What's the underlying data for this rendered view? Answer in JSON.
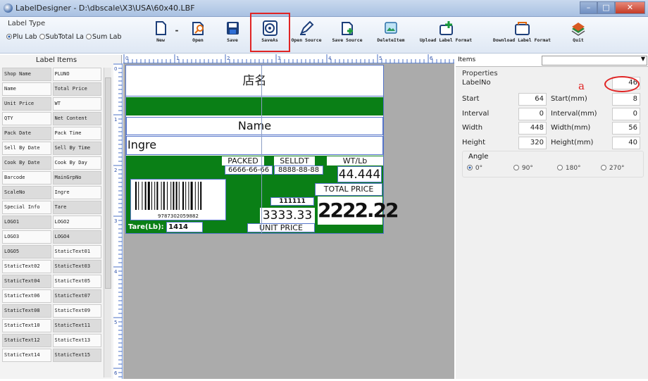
{
  "window": {
    "title": "LabelDesigner - D:\\dbscale\\X3\\USA\\60x40.LBF",
    "min": "–",
    "max": "□",
    "close": "✕"
  },
  "label_type": {
    "title": "Label Type",
    "options": [
      "Plu Lab",
      "SubTotal La",
      "Sum Lab"
    ],
    "selected": 0
  },
  "toolbar": {
    "new": "New",
    "open": "Open",
    "save": "Save",
    "saveas": "SaveAs",
    "open_source": "Open Source",
    "save_source": "Save Source",
    "delete_item": "DeleteItem",
    "upload_label_format": "Upload Label Format",
    "download_label_format": "Download Label Format",
    "quit": "Quit"
  },
  "left_panel": {
    "title": "Label Items",
    "rows": [
      [
        "Shop Name",
        "PLUNO"
      ],
      [
        "Name",
        "Total Price"
      ],
      [
        "Unit Price",
        "WT"
      ],
      [
        "QTY",
        "Net Content"
      ],
      [
        "Pack Date",
        "Pack Time"
      ],
      [
        "Sell By Date",
        "Sell By Time"
      ],
      [
        "Cook By Date",
        "Cook By Day"
      ],
      [
        "Barcode",
        "MainGrpNo"
      ],
      [
        "ScaleNo",
        "Ingre"
      ],
      [
        "Special Info",
        "Tare"
      ],
      [
        "LOGO1",
        "LOGO2"
      ],
      [
        "LOGO3",
        "LOGO4"
      ],
      [
        "LOGO5",
        "StaticText01"
      ],
      [
        "StaticText02",
        "StaticText03"
      ],
      [
        "StaticText04",
        "StaticText05"
      ],
      [
        "StaticText06",
        "StaticText07"
      ],
      [
        "StaticText08",
        "StaticText09"
      ],
      [
        "StaticText10",
        "StaticText11"
      ],
      [
        "StaticText12",
        "StaticText13"
      ],
      [
        "StaticText14",
        "StaticText15"
      ]
    ]
  },
  "ruler": {
    "top_marks": [
      "0",
      "1",
      "2",
      "3",
      "4",
      "5",
      "6"
    ],
    "left_marks": [
      "0",
      "1",
      "2",
      "3",
      "4",
      "5",
      "6"
    ]
  },
  "label": {
    "shop_name": "店名",
    "name": "Name",
    "ingre": "Ingre",
    "packed": "PACKED",
    "sell_dt": "SELLDT",
    "wt_lb": "WT/Lb",
    "pack_date": "6666-66-66",
    "sell_date": "8888-88-88",
    "weight": "44.444",
    "total_price_label": "TOTAL PRICE",
    "total_price": "2222.22",
    "plu": "111111",
    "unit_price": "3333.33",
    "unit_price_label": "UNIT PRICE",
    "barcode_number": "9787302059882",
    "tare_label": "Tare(Lb):",
    "tare_value": "1414"
  },
  "right_panel": {
    "items_label": "Items",
    "properties": "Properties",
    "label_no_label": "LabelNo",
    "label_no": "46",
    "annotation": "a",
    "start_label": "Start",
    "start": "64",
    "start_mm_label": "Start(mm)",
    "start_mm": "8",
    "interval_label": "Interval",
    "interval": "0",
    "interval_mm_label": "Interval(mm)",
    "interval_mm": "0",
    "width_label": "Width",
    "width": "448",
    "width_mm_label": "Width(mm)",
    "width_mm": "56",
    "height_label": "Height",
    "height": "320",
    "height_mm_label": "Height(mm)",
    "height_mm": "40",
    "angle_label": "Angle",
    "angles": [
      "0°",
      "90°",
      "180°",
      "270°"
    ],
    "angle_selected": 0
  },
  "colors": {
    "label_green": "#0a7f16",
    "highlight_red": "#e02424",
    "selection_blue": "#5574c9"
  }
}
